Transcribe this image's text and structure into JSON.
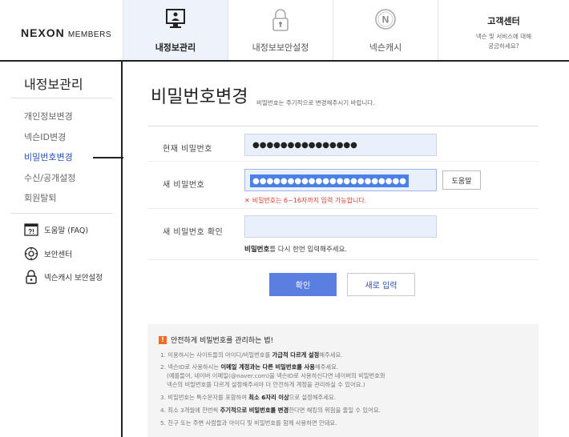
{
  "header": {
    "logo_main": "NEXON",
    "logo_sub": "MEMBERS",
    "tabs": [
      {
        "label": "내정보관리"
      },
      {
        "label": "내정보보안설정"
      },
      {
        "label": "넥슨캐시"
      }
    ],
    "support": {
      "title": "고객센터",
      "desc_line1": "넥슨 및 서비스에 대해",
      "desc_line2": "궁금하세요?"
    }
  },
  "sidebar": {
    "title": "내정보관리",
    "items": [
      {
        "label": "개인정보변경"
      },
      {
        "label": "넥슨ID변경"
      },
      {
        "label": "비밀번호변경"
      },
      {
        "label": "수신/공개설정"
      },
      {
        "label": "회원탈퇴"
      }
    ],
    "sub_items": [
      {
        "label": "도움말 (FAQ)",
        "icon": "faq-icon"
      },
      {
        "label": "보안센터",
        "icon": "security-center-icon"
      },
      {
        "label": "넥슨캐시 보안설정",
        "icon": "lock-icon"
      }
    ]
  },
  "main": {
    "title": "비밀번호변경",
    "description": "비밀번호는 주기적으로 변경해주시기 바랍니다.",
    "current_pw_label": "현재 비밀번호",
    "current_pw_value": "●●●●●●●●●●●●●●●",
    "new_pw_label": "새 비밀번호",
    "new_pw_value": "●●●●●●●●●●●●●●●●●●●●●●",
    "help_button": "도움말",
    "error_mark": "✕",
    "error_text": "비밀번호는 6~16자까지 입력 가능합니다.",
    "confirm_label": "새 비밀번호 확인",
    "confirm_value": "",
    "confirm_note_bold": "비밀번호",
    "confirm_note_rest": "를 다시 한번 입력해주세요.",
    "confirm_button": "확인",
    "reset_button": "새로 입력"
  },
  "tips": {
    "title": "안전하게 비밀번호를 관리하는 법!",
    "t1_a": "1. 이용하시는 사이트들의 아이디/비밀번호를 ",
    "t1_b": "가급적 다르게 설정",
    "t1_c": "해주세요.",
    "t2_a": "2. 넥슨ID로 사용하시는 ",
    "t2_b": "이메일 계정과는 다른 비밀번호를 사용",
    "t2_c": "해주세요.",
    "t2_d": "(예를들어, 네이버 이메일(@naver.com)을 넥슨ID로 사용하신다면 네이버의 비밀번호와",
    "t2_e": "넥슨의 비밀번호를 다르게 설정해주셔야 더 안전하게 계정을 관리하실 수 있어요.)",
    "t3_a": "3. 비밀번호는 특수문자를 포함하여 ",
    "t3_b": "최소 6자리 이상",
    "t3_c": "으로 설정해주세요.",
    "t4_a": "4. 최소 3개월에 한번씩 ",
    "t4_b": "주기적으로 비밀번호를 변경",
    "t4_c": "한다면 해킹의 위험을 줄일 수 있어요.",
    "t5": "5. 친구 또는 주변 사람들과 아이디 및 비밀번호를 함께 사용하면 안돼요."
  },
  "colors": {
    "accent": "#5b7fe0",
    "active_link": "#2a4fb6",
    "error": "#e03a2e",
    "input_bg": "#e9f0fc",
    "warn": "#f06a28"
  }
}
